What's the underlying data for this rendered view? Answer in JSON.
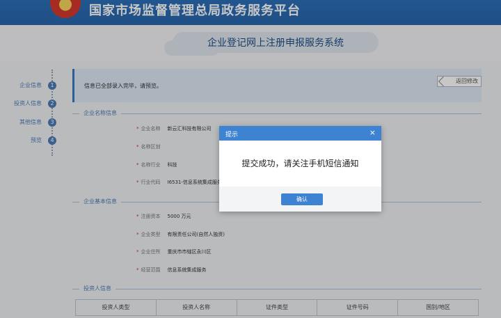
{
  "header": {
    "title": "国家市场监督管理总局政务服务平台",
    "subtitle": "企业登记网上注册申报服务系统"
  },
  "steps": [
    {
      "label": "企业信息",
      "num": "1"
    },
    {
      "label": "投资人信息",
      "num": "2"
    },
    {
      "label": "其他信息",
      "num": "3"
    },
    {
      "label": "预览",
      "num": "4"
    }
  ],
  "notice": {
    "text": "信息已全部录入完毕，请预览。",
    "return_label": "返回修改"
  },
  "sections": {
    "name_info": "企业名称信息",
    "basic_info": "企业基本信息",
    "investor_info": "投资人信息"
  },
  "name_fields": [
    {
      "label": "企业名称",
      "value": "新云汇科技有限公司"
    },
    {
      "label": "名称区划",
      "value": ""
    },
    {
      "label": "名称行业",
      "value": "科技"
    },
    {
      "label": "行业代码",
      "value": "I6531-信息系统集成服务"
    }
  ],
  "basic_fields": [
    {
      "label": "注册资本",
      "value": "5000  万元"
    },
    {
      "label": "企业类型",
      "value": "有限责任公司(自然人独资)"
    },
    {
      "label": "企业住所",
      "value": "重庆市市辖区永川区"
    },
    {
      "label": "经营范围",
      "value": "信息系统集成服务"
    }
  ],
  "investor_table": {
    "headers": [
      "投资人类型",
      "投资人名称",
      "证件类型",
      "证件号码",
      "国别/地区"
    ]
  },
  "modal": {
    "title": "提示",
    "close_glyph": "×",
    "message": "提交成功，请关注手机短信通知",
    "ok_label": "确认"
  }
}
